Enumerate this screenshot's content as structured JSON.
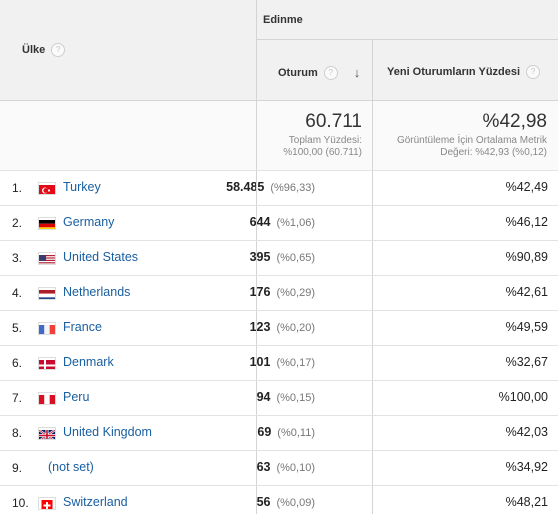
{
  "header": {
    "country_label": "Ülke",
    "group_label": "Edinme",
    "col_sessions": "Oturum",
    "col_new_rate": "Yeni Oturumların Yüzdesi",
    "help_glyph": "?",
    "sort_glyph": "↓"
  },
  "totals": {
    "sessions": "60.711",
    "sessions_sub1": "Toplam Yüzdesi:",
    "sessions_sub2": "%100,00 (60.711)",
    "new_rate": "%42,98",
    "new_rate_sub1": "Görüntüleme İçin Ortalama Metrik",
    "new_rate_sub2": "Değeri: %42,93 (%0,12)"
  },
  "rows": [
    {
      "idx": "1.",
      "country": "Turkey",
      "flag": "tr",
      "sessions": "58.485",
      "pct": "(%96,33)",
      "new_rate": "%42,49"
    },
    {
      "idx": "2.",
      "country": "Germany",
      "flag": "de",
      "sessions": "644",
      "pct": "(%1,06)",
      "new_rate": "%46,12"
    },
    {
      "idx": "3.",
      "country": "United States",
      "flag": "us",
      "sessions": "395",
      "pct": "(%0,65)",
      "new_rate": "%90,89"
    },
    {
      "idx": "4.",
      "country": "Netherlands",
      "flag": "nl",
      "sessions": "176",
      "pct": "(%0,29)",
      "new_rate": "%42,61"
    },
    {
      "idx": "5.",
      "country": "France",
      "flag": "fr",
      "sessions": "123",
      "pct": "(%0,20)",
      "new_rate": "%49,59"
    },
    {
      "idx": "6.",
      "country": "Denmark",
      "flag": "dk",
      "sessions": "101",
      "pct": "(%0,17)",
      "new_rate": "%32,67"
    },
    {
      "idx": "7.",
      "country": "Peru",
      "flag": "pe",
      "sessions": "94",
      "pct": "(%0,15)",
      "new_rate": "%100,00"
    },
    {
      "idx": "8.",
      "country": "United Kingdom",
      "flag": "gb",
      "sessions": "69",
      "pct": "(%0,11)",
      "new_rate": "%42,03"
    },
    {
      "idx": "9.",
      "country": "(not set)",
      "flag": "",
      "sessions": "63",
      "pct": "(%0,10)",
      "new_rate": "%34,92"
    },
    {
      "idx": "10.",
      "country": "Switzerland",
      "flag": "ch",
      "sessions": "56",
      "pct": "(%0,09)",
      "new_rate": "%48,21"
    }
  ]
}
